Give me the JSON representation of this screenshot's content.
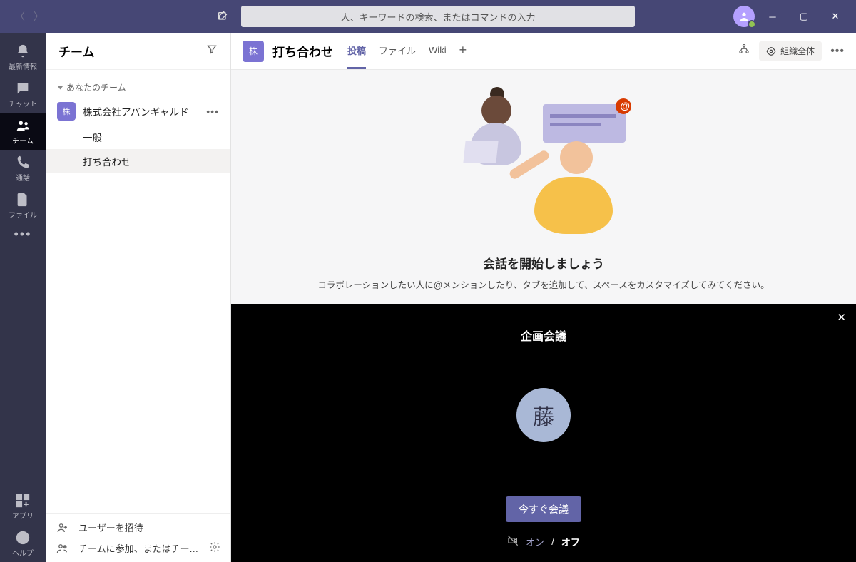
{
  "titlebar": {
    "search_placeholder": "人、キーワードの検索、またはコマンドの入力"
  },
  "rail": {
    "activity": "最新情報",
    "chat": "チャット",
    "teams": "チーム",
    "calls": "通話",
    "files": "ファイル",
    "apps": "アプリ",
    "help": "ヘルプ"
  },
  "sidebar": {
    "title": "チーム",
    "yours_label": "あなたのチーム",
    "team": {
      "badge": "株",
      "name": "株式会社アバンギャルド"
    },
    "channels": {
      "general": "一般",
      "meeting": "打ち合わせ"
    },
    "footer": {
      "invite": "ユーザーを招待",
      "join_create": "チームに参加、またはチームを..."
    }
  },
  "channel": {
    "badge": "株",
    "name": "打ち合わせ",
    "tabs": {
      "posts": "投稿",
      "files": "ファイル",
      "wiki": "Wiki"
    },
    "org_label": "組織全体"
  },
  "empty": {
    "title": "会話を開始しましょう",
    "desc": "コラボレーションしたい人に@メンションしたり、タブを追加して、スペースをカスタマイズしてみてください。"
  },
  "meeting": {
    "title": "企画会議",
    "avatar_char": "藤",
    "join_label": "今すぐ会議",
    "cam_on": "オン",
    "cam_off": "オフ"
  }
}
